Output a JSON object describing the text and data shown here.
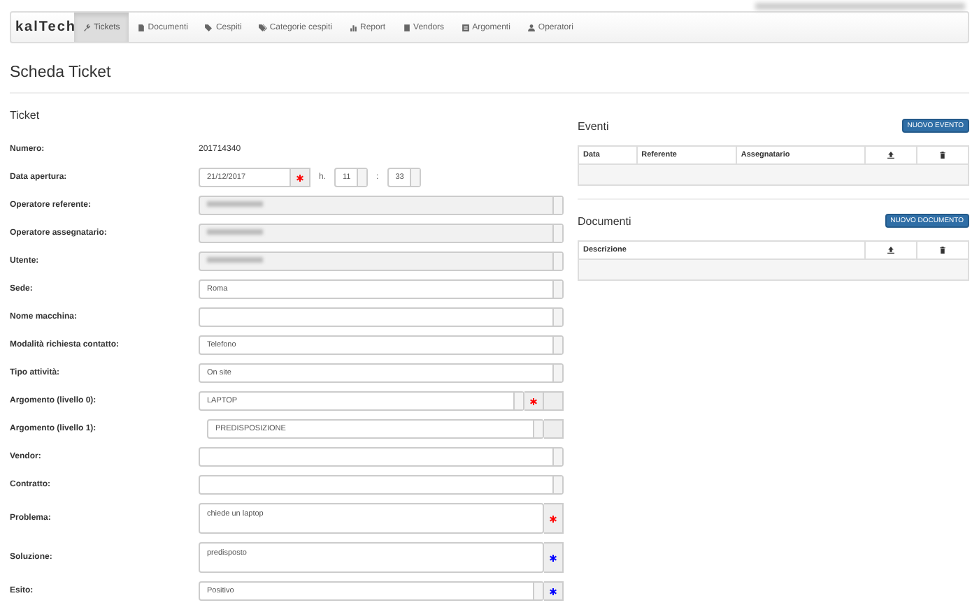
{
  "navbar": {
    "logo": "kalTech",
    "tabs": [
      {
        "label": "Tickets",
        "selected": true
      },
      {
        "label": "Documenti",
        "selected": false
      },
      {
        "label": "Cespiti",
        "selected": false
      },
      {
        "label": "Categorie cespiti",
        "selected": false
      },
      {
        "label": "Report",
        "selected": false
      },
      {
        "label": "Vendors",
        "selected": false
      },
      {
        "label": "Argomenti",
        "selected": false
      },
      {
        "label": "Operatori",
        "selected": false
      }
    ]
  },
  "page_title": "Scheda Ticket",
  "ticket": {
    "heading": "Ticket",
    "fields": [
      {
        "label": "Numero:",
        "kind": "static",
        "value": "201714340"
      },
      {
        "label": "Data apertura:",
        "kind": "datetime",
        "date": "21/12/2017",
        "marker": {
          "color": "#ff0000"
        },
        "hour_prefix": "h.",
        "hour": "11",
        "separator": ":",
        "minute": "33"
      },
      {
        "label": "Operatore referente:",
        "kind": "select",
        "disabled": true
      },
      {
        "label": "Operatore assegnatario:",
        "kind": "select",
        "disabled": true
      },
      {
        "label": "Utente:",
        "kind": "select",
        "disabled": true
      },
      {
        "label": "Sede:",
        "kind": "select",
        "value": "Roma"
      },
      {
        "label": "Nome macchina:",
        "kind": "select"
      },
      {
        "label": "Modalità richiesta contatto:",
        "kind": "select",
        "value": "Telefono"
      },
      {
        "label": "Tipo attività:",
        "kind": "select",
        "value": "On site"
      },
      {
        "label": "Argomento (livello 0):",
        "kind": "select",
        "value": "LAPTOP",
        "marker": {
          "color": "#ff0000"
        },
        "trailing_addon": true
      },
      {
        "label": "Argomento (livello 1):",
        "kind": "select",
        "value": "PREDISPOSIZIONE",
        "indented": true,
        "trailing_addon": true
      },
      {
        "label": "Vendor:",
        "kind": "select"
      },
      {
        "label": "Contratto:",
        "kind": "select"
      },
      {
        "label": "Problema:",
        "kind": "textarea",
        "value": "chiede un laptop",
        "marker": {
          "color": "#ff0000"
        }
      },
      {
        "label": "Soluzione:",
        "kind": "textarea",
        "value": "predisposto",
        "marker": {
          "color": "#0000ff"
        }
      },
      {
        "label": "Esito:",
        "kind": "select",
        "value": "Positivo",
        "marker": {
          "color": "#0000ff"
        }
      }
    ]
  },
  "eventi": {
    "heading": "Eventi",
    "button": "NUOVO EVENTO",
    "columns": [
      "Data",
      "Referente",
      "Assegnatario"
    ]
  },
  "documenti": {
    "heading": "Documenti",
    "button": "NUOVO DOCUMENTO",
    "columns": [
      "Descrizione"
    ]
  }
}
